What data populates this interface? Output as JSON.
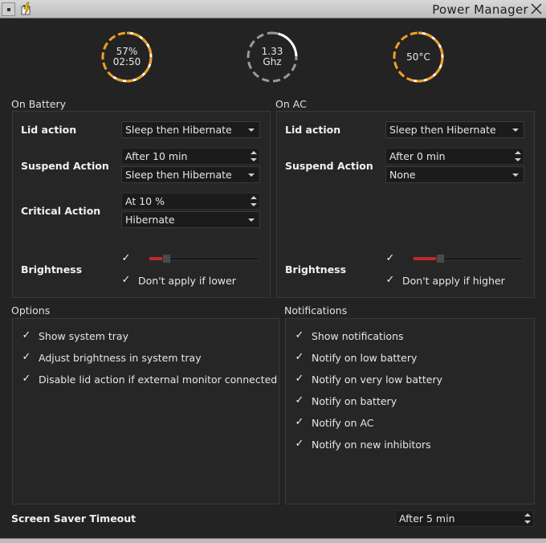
{
  "window": {
    "title": "Power Manager"
  },
  "gauges": {
    "battery": {
      "line1": "57%",
      "line2": "02:50",
      "percent": 57,
      "color": "#f0a020"
    },
    "cpu": {
      "line1": "1.33",
      "line2": "Ghz",
      "color": "#9a9a9a"
    },
    "temp": {
      "line1": "50°C",
      "color": "#f0a020"
    }
  },
  "battery": {
    "group_label": "On Battery",
    "lid_label": "Lid action",
    "lid_value": "Sleep then Hibernate",
    "suspend_label": "Suspend Action",
    "suspend_time": "After 10 min",
    "suspend_value": "Sleep then Hibernate",
    "critical_label": "Critical Action",
    "critical_level": "At 10 %",
    "critical_value": "Hibernate",
    "brightness_label": "Brightness",
    "brightness_level": 0.13,
    "dont_apply_label": "Don't apply if lower"
  },
  "ac": {
    "group_label": "On AC",
    "lid_label": "Lid action",
    "lid_value": "Sleep then Hibernate",
    "suspend_label": "Suspend Action",
    "suspend_time": "After 0 min",
    "suspend_value": "None",
    "brightness_label": "Brightness",
    "brightness_level": 0.22,
    "dont_apply_label": "Don't apply if higher"
  },
  "options": {
    "group_label": "Options",
    "items": [
      "Show system tray",
      "Adjust brightness in system tray",
      "Disable lid action if external monitor connected"
    ]
  },
  "notifications": {
    "group_label": "Notifications",
    "items": [
      "Show notifications",
      "Notify on low battery",
      "Notify on very low battery",
      "Notify on battery",
      "Notify on AC",
      "Notify on new inhibitors"
    ]
  },
  "screensaver": {
    "label": "Screen Saver Timeout",
    "value": "After 5 min"
  },
  "check_glyph": "✓",
  "colors": {
    "accent_orange": "#f0a020",
    "slider_red": "#c02a2a",
    "background": "#232323"
  }
}
